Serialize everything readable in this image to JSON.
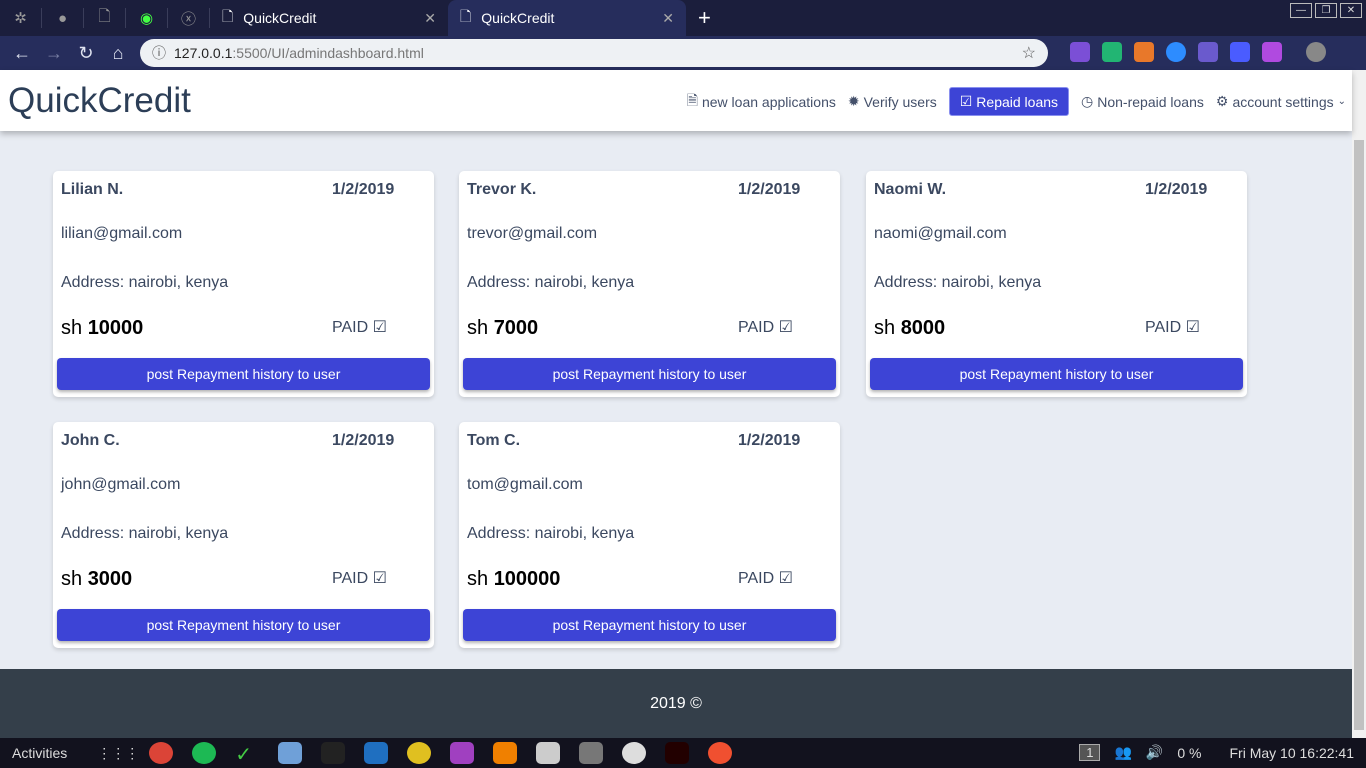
{
  "browser": {
    "tabs": [
      {
        "title": "QuickCredit"
      },
      {
        "title": "QuickCredit"
      }
    ],
    "url_host": "127.0.0.1",
    "url_rest": ":5500/UI/admindashboard.html"
  },
  "header": {
    "logo": "QuickCredit",
    "menu": [
      {
        "label": "new loan applications",
        "icon": "file-icon",
        "glyph": "🗎"
      },
      {
        "label": "Verify users",
        "icon": "badge-icon",
        "glyph": "✹"
      },
      {
        "label": "Repaid loans",
        "icon": "check-square-icon",
        "glyph": "☑"
      },
      {
        "label": "Non-repaid loans",
        "icon": "clock-icon",
        "glyph": "◷"
      },
      {
        "label": "account settings",
        "icon": "gear-icon",
        "glyph": "⚙"
      }
    ]
  },
  "cards": [
    {
      "name": "Lilian N.",
      "date": "1/2/2019",
      "email": "lilian@gmail.com",
      "address": "Address: nairobi, kenya",
      "currency": "sh",
      "amount": "10000",
      "status": "PAID",
      "button": "post Repayment history to user"
    },
    {
      "name": "Trevor K.",
      "date": "1/2/2019",
      "email": "trevor@gmail.com",
      "address": "Address: nairobi, kenya",
      "currency": "sh",
      "amount": "7000",
      "status": "PAID",
      "button": "post Repayment history to user"
    },
    {
      "name": "Naomi W.",
      "date": "1/2/2019",
      "email": "naomi@gmail.com",
      "address": "Address: nairobi, kenya",
      "currency": "sh",
      "amount": "8000",
      "status": "PAID",
      "button": "post Repayment history to user"
    },
    {
      "name": "John C.",
      "date": "1/2/2019",
      "email": "john@gmail.com",
      "address": "Address: nairobi, kenya",
      "currency": "sh",
      "amount": "3000",
      "status": "PAID",
      "button": "post Repayment history to user"
    },
    {
      "name": "Tom C.",
      "date": "1/2/2019",
      "email": "tom@gmail.com",
      "address": "Address: nairobi, kenya",
      "currency": "sh",
      "amount": "100000",
      "status": "PAID",
      "button": "post Repayment history to user"
    }
  ],
  "footer": {
    "text": "2019 ©"
  },
  "taskbar": {
    "activities": "Activities",
    "workspace": "1",
    "battery": "0 %",
    "clock": "Fri May 10  16:22:41"
  }
}
